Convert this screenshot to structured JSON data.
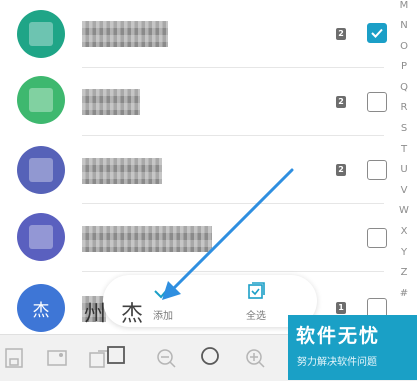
{
  "contacts": [
    {
      "avatar_color": "#1fa587",
      "sim_badge": "2",
      "checked": true
    },
    {
      "avatar_color": "#3eb86f",
      "sim_badge": "2",
      "checked": false
    },
    {
      "avatar_color": "#5662b8",
      "sim_badge": "2",
      "checked": false
    },
    {
      "avatar_color": "#5a60bf",
      "sim_badge": "",
      "checked": false
    },
    {
      "avatar_color": "#3e76d6",
      "avatar_char": "杰",
      "sim_badge": "1",
      "checked": false
    }
  ],
  "alphabet_index": [
    "M",
    "N",
    "O",
    "P",
    "Q",
    "R",
    "S",
    "T",
    "U",
    "V",
    "W",
    "X",
    "Y",
    "Z",
    "#"
  ],
  "action_bar": {
    "add_label": "添加",
    "select_all_label": "全选"
  },
  "partial_name_text": "州 杰",
  "watermark": {
    "title": "软件无忧",
    "subtitle": "努力解决软件问题"
  },
  "accent_color": "#1b9fc7",
  "arrow_color": "#2f8fe0"
}
